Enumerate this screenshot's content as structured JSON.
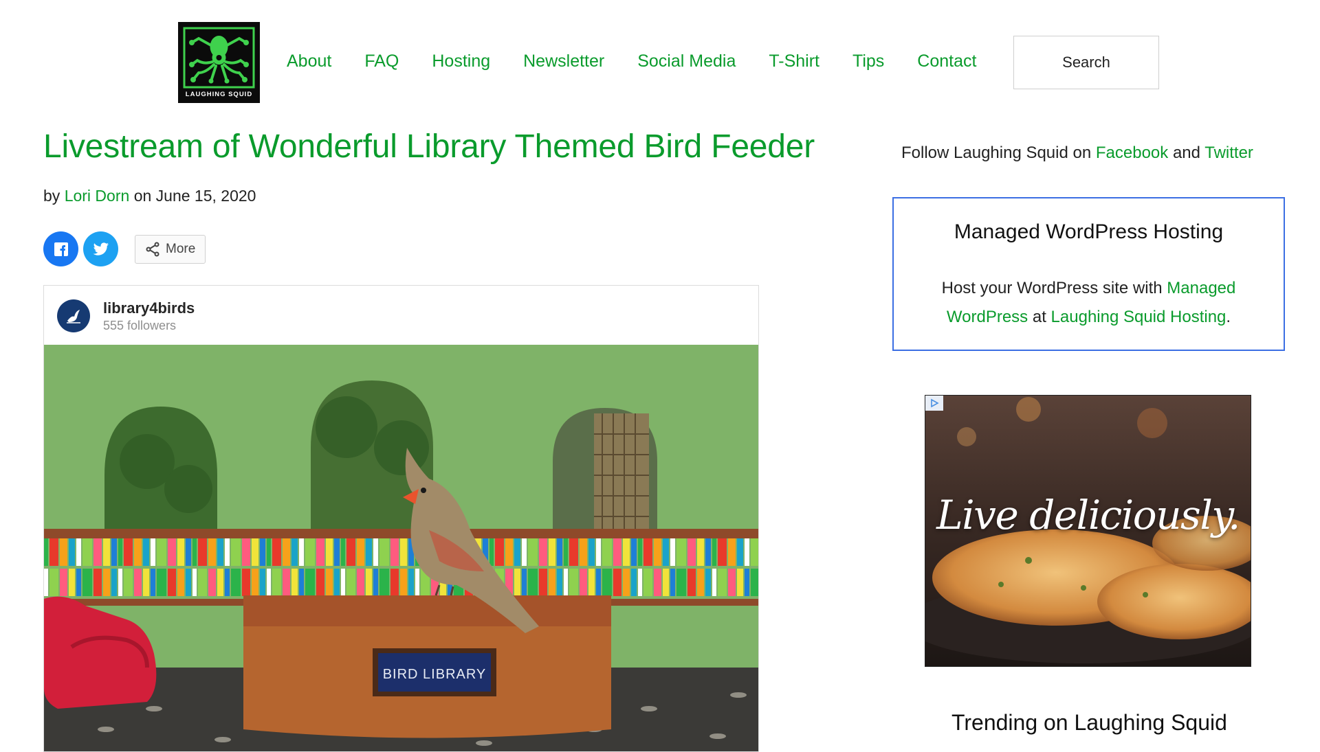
{
  "header": {
    "logo_text": "LAUGHING SQUID",
    "nav": [
      "About",
      "FAQ",
      "Hosting",
      "Newsletter",
      "Social Media",
      "T-Shirt",
      "Tips",
      "Contact"
    ],
    "search_label": "Search"
  },
  "article": {
    "title": "Livestream of Wonderful Library Themed Bird Feeder",
    "by": "by",
    "author": "Lori Dorn",
    "on": "on June 15, 2020",
    "share": {
      "more_label": "More"
    }
  },
  "embed": {
    "username": "library4birds",
    "followers": "555 followers",
    "photo_sign": "BIRD LIBRARY"
  },
  "sidebar": {
    "follow": {
      "prefix": "Follow Laughing Squid on",
      "facebook": "Facebook",
      "and": "and",
      "twitter": "Twitter"
    },
    "hosting": {
      "title": "Managed WordPress Hosting",
      "text_prefix": "Host your WordPress site with",
      "link1": "Managed WordPress",
      "at": "at",
      "link2": "Laughing Squid Hosting",
      "end": "."
    },
    "ad_text": "Live deliciously.",
    "trending": "Trending on Laughing Squid"
  },
  "colors": {
    "link": "#0a9b2c",
    "facebook": "#1877f2",
    "twitter": "#1da1f2",
    "box_border": "#3b6ee3"
  }
}
